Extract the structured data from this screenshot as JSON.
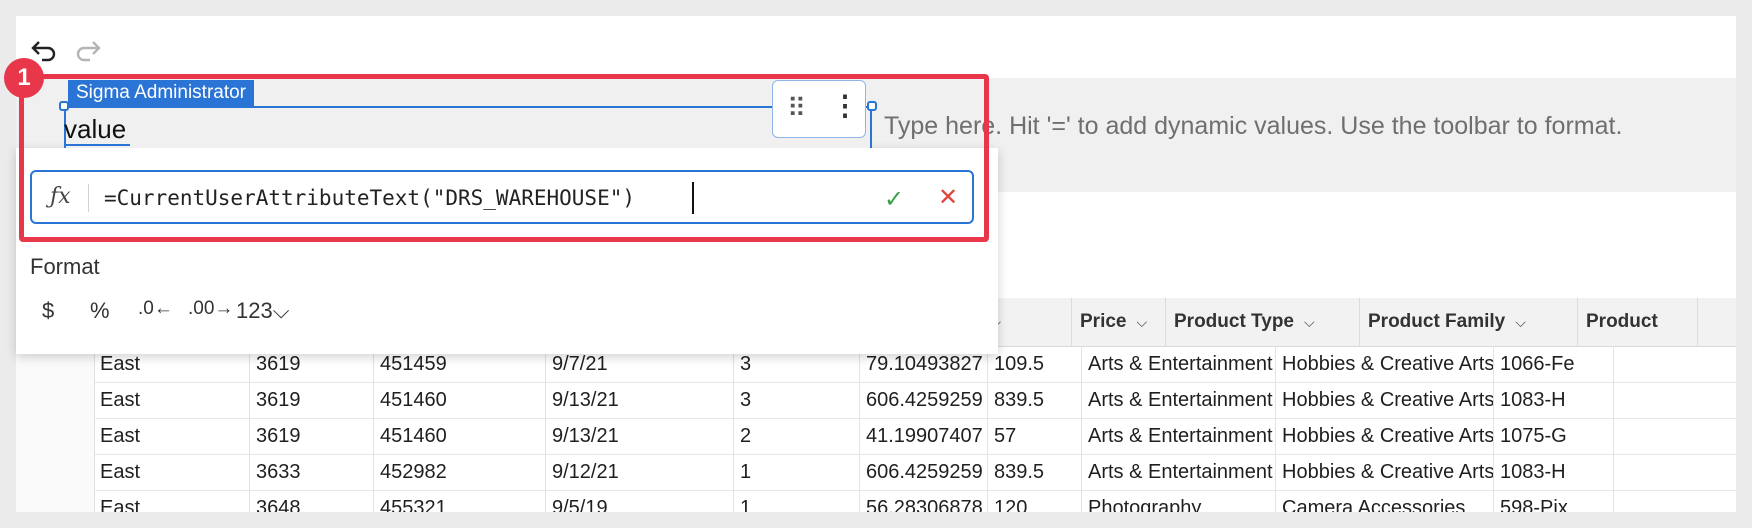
{
  "toolbar": {
    "undo_icon": "undo-icon",
    "redo_icon": "redo-icon"
  },
  "text_element": {
    "value": "value",
    "user_tag": "Sigma Administrator",
    "placeholder": "Type here. Hit '=' to add dynamic values. Use the toolbar to format."
  },
  "formula": {
    "fx_label": "ƒx",
    "text": "=CurrentUserAttributeText(\"DRS_WAREHOUSE\")",
    "confirm_icon": "✓",
    "cancel_icon": "✕"
  },
  "format": {
    "label": "Format",
    "buttons": [
      "$",
      "%",
      ".0←",
      ".00→",
      "123⌵"
    ]
  },
  "annotation": {
    "step": "1"
  },
  "table": {
    "headers": [
      "t",
      "Price",
      "Product Type",
      "Product Family",
      "Product"
    ],
    "rows": [
      [
        "East",
        "3619",
        "451459",
        "9/7/21",
        "3",
        "79.10493827",
        "109.5",
        "Arts & Entertainment",
        "Hobbies & Creative Arts",
        "1066-Fe"
      ],
      [
        "East",
        "3619",
        "451460",
        "9/13/21",
        "3",
        "606.4259259",
        "839.5",
        "Arts & Entertainment",
        "Hobbies & Creative Arts",
        "1083-H"
      ],
      [
        "East",
        "3619",
        "451460",
        "9/13/21",
        "2",
        "41.19907407",
        "57",
        "Arts & Entertainment",
        "Hobbies & Creative Arts",
        "1075-G"
      ],
      [
        "East",
        "3633",
        "452982",
        "9/12/21",
        "1",
        "606.4259259",
        "839.5",
        "Arts & Entertainment",
        "Hobbies & Creative Arts",
        "1083-H"
      ],
      [
        "East",
        "3648",
        "455321",
        "9/5/19",
        "1",
        "56.28306878",
        "120",
        "Photography",
        "Camera Accessories",
        "598-Pix"
      ]
    ]
  },
  "colors": {
    "accent": "#2a74d6",
    "annotation": "#e8374a",
    "confirm": "#3aa14a",
    "cancel": "#e0453e"
  }
}
